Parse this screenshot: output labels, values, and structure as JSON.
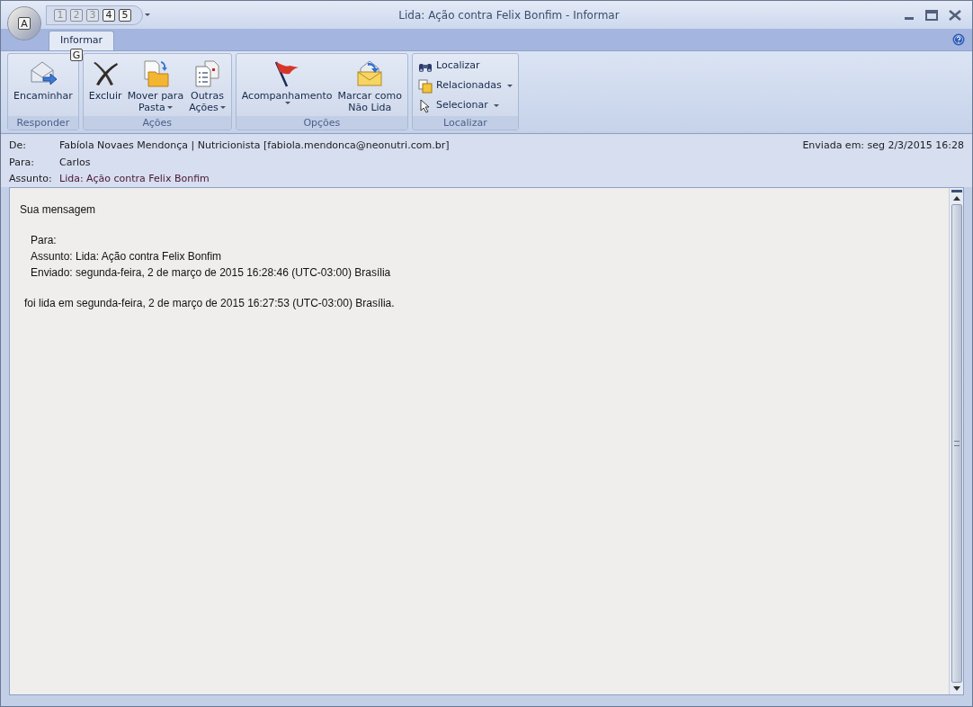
{
  "window": {
    "title": "Lida: Ação contra Felix Bonfim - Informar"
  },
  "office_button": {
    "keytip": "A"
  },
  "quick_access": [
    {
      "keytip": "1",
      "disabled": true
    },
    {
      "keytip": "2",
      "disabled": true
    },
    {
      "keytip": "3",
      "disabled": true
    },
    {
      "keytip": "4",
      "disabled": false
    },
    {
      "keytip": "5",
      "disabled": false
    }
  ],
  "tabs": [
    {
      "label": "Informar",
      "selected": true,
      "keytip": "G"
    }
  ],
  "ribbon_groups": [
    {
      "label": "Responder",
      "kind": "large",
      "buttons": [
        {
          "lines": [
            "Encaminhar"
          ],
          "dropdown": false
        }
      ]
    },
    {
      "label": "Ações",
      "kind": "large",
      "buttons": [
        {
          "lines": [
            "Excluir"
          ],
          "dropdown": false
        },
        {
          "lines": [
            "Mover para",
            "Pasta"
          ],
          "dropdown": true
        },
        {
          "lines": [
            "Outras",
            "Ações"
          ],
          "dropdown": true
        }
      ]
    },
    {
      "label": "Opções",
      "kind": "large",
      "buttons": [
        {
          "lines": [
            "Acompanhamento"
          ],
          "dropdown": true
        },
        {
          "lines": [
            "Marcar como",
            "Não Lida"
          ],
          "dropdown": false
        }
      ]
    },
    {
      "label": "Localizar",
      "kind": "small",
      "buttons": [
        {
          "lines": [
            "Localizar"
          ],
          "dropdown": false
        },
        {
          "lines": [
            "Relacionadas"
          ],
          "dropdown": true
        },
        {
          "lines": [
            "Selecionar"
          ],
          "dropdown": true
        }
      ]
    }
  ],
  "header": {
    "from_label": "De:",
    "from": "Fabíola Novaes Mendonça | Nutricionista [fabiola.mendonca@neonutri.com.br]",
    "to_label": "Para:",
    "to": "Carlos",
    "subject_label": "Assunto:",
    "subject": "Lida: Ação contra Felix Bonfim",
    "sent_label": "Enviada em:",
    "sent": "seg 2/3/2015 16:28"
  },
  "body": {
    "intro": "Sua mensagem",
    "details": [
      "Para:",
      "Assunto: Lida: Ação contra Felix Bonfim",
      "Enviado: segunda-feira, 2 de março de 2015 16:28:46 (UTC-03:00) Brasília"
    ],
    "closing": "foi lida em segunda-feira, 2 de março de 2015 16:27:53 (UTC-03:00) Brasília."
  }
}
